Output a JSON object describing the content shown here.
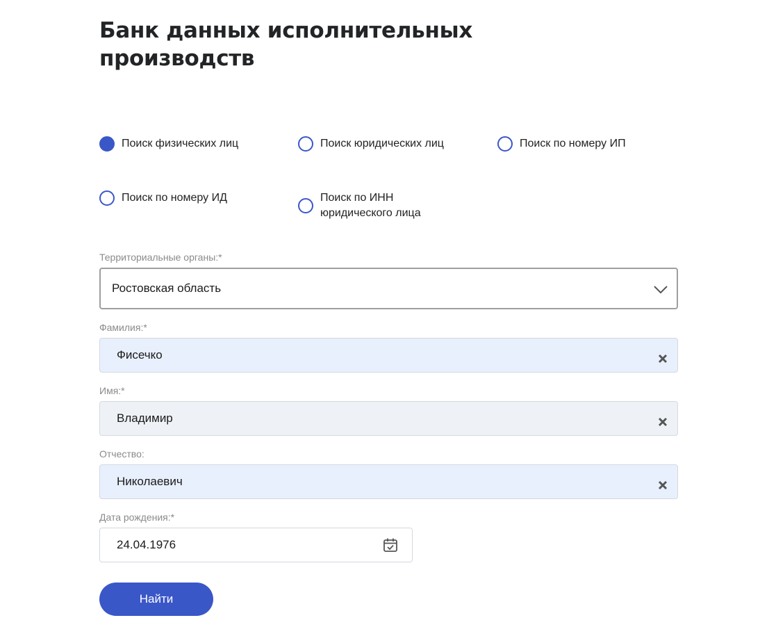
{
  "page": {
    "title": "Банк данных исполнительных производств"
  },
  "search_modes": [
    {
      "label": "Поиск физических лиц",
      "checked": true
    },
    {
      "label": "Поиск юридических лиц",
      "checked": false
    },
    {
      "label": "Поиск по номеру ИП",
      "checked": false
    },
    {
      "label": "Поиск по номеру ИД",
      "checked": false
    },
    {
      "label": "Поиск по ИНН юридического лица",
      "checked": false
    }
  ],
  "form": {
    "region": {
      "label": "Территориальные органы:*",
      "value": "Ростовская область"
    },
    "last_name": {
      "label": "Фамилия:*",
      "value": "Фисечко"
    },
    "first_name": {
      "label": "Имя:*",
      "value": "Владимир"
    },
    "patronymic": {
      "label": "Отчество:",
      "value": "Николаевич"
    },
    "birth_date": {
      "label": "Дата рождения:*",
      "value": "24.04.1976"
    },
    "submit_label": "Найти"
  },
  "icons": {
    "dropdown": "chevron-down-icon",
    "clear": "close-icon",
    "date": "calendar-icon"
  },
  "colors": {
    "accent": "#3a57c8",
    "autofill_bg": "#e8f0fe",
    "input_bg_grey": "#eef2f6",
    "label_grey": "#8a8a8a"
  }
}
